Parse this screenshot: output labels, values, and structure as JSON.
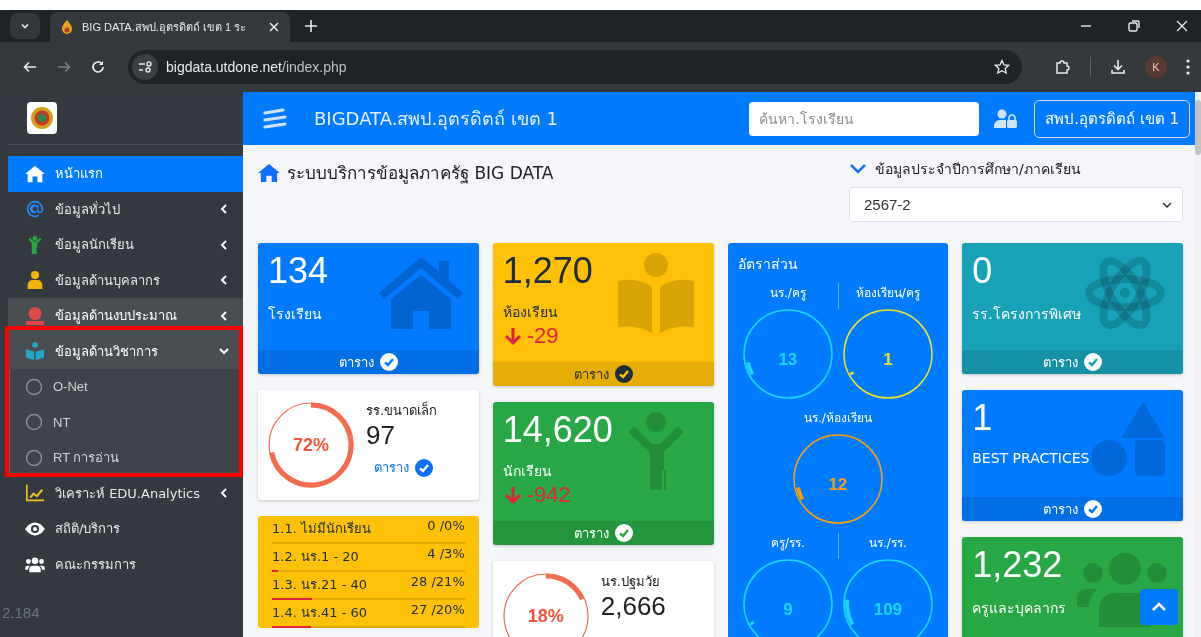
{
  "browser": {
    "tabs": [
      {
        "title": "BIG DATA.สพป.อุตรดิตถ์ เขต 1 ระ"
      }
    ],
    "url_host": "bigdata.utdone.net",
    "url_path": "/index.php",
    "profile": "K"
  },
  "sidebar": {
    "version": "2.184",
    "items": [
      {
        "label": "หน้าแรก",
        "selected": true,
        "hovered": false
      },
      {
        "label": "ข้อมูลทั่วไป",
        "selected": false,
        "hovered": false,
        "expanded": false
      },
      {
        "label": "ข้อมูลนักเรียน",
        "selected": false,
        "hovered": false,
        "expanded": false
      },
      {
        "label": "ข้อมูลด้านบุคลากร",
        "selected": false,
        "hovered": false,
        "expanded": false
      },
      {
        "label": "ข้อมูลด้านงบประมาณ",
        "selected": false,
        "hovered": true,
        "expanded": false
      },
      {
        "label": "ข้อมูลด้านวิชาการ",
        "selected": false,
        "hovered": false,
        "expanded": true,
        "children": [
          {
            "label": "O-Net",
            "selected": false
          },
          {
            "label": "NT",
            "selected": false
          },
          {
            "label": "RT การอ่าน",
            "selected": false
          }
        ]
      },
      {
        "label": "วิเคราะห์ EDU.Analytics",
        "selected": false,
        "hovered": false,
        "expanded": false
      },
      {
        "label": "สถิติ/บริการ",
        "selected": false,
        "hovered": false
      },
      {
        "label": "คณะกรรมการ",
        "selected": false,
        "hovered": false
      }
    ]
  },
  "header": {
    "title": "BIGDATA.สพป.อุตรดิตถ์ เขต 1",
    "search": {
      "placeholder": "ค้นหา.โรงเรียน"
    },
    "account_button": "สพป.อุตรดิตถ์ เขต 1"
  },
  "content": {
    "title": "ระบบบริการข้อมูลภาครัฐ BIG DATA",
    "year_label": "ข้อมูลประจำปีการศึกษา/ภาคเรียน",
    "year_select": "2567-2",
    "columns": [
      [
        {
          "kind": "stat",
          "color": "#007bff",
          "value": "134",
          "label": "โรงเรียน",
          "link": "ตาราง"
        },
        {
          "kind": "donut",
          "percent": "72%",
          "label": "รร.ขนาดเล็ก",
          "value": "97",
          "link": "ตาราง"
        },
        {
          "kind": "list",
          "rows": [
            {
              "label": "1.1. ไม่มีนักเรียน",
              "value": "0 /0%",
              "level": 0
            },
            {
              "label": "1.2. นร.1 - 20",
              "value": "4 /3%",
              "level": 0.03
            },
            {
              "label": "1.3. นร.21 - 40",
              "value": "28 /21%",
              "level": 0.21
            },
            {
              "label": "1.4. นร.41 - 60",
              "value": "27 /20%",
              "level": 0.2
            }
          ]
        }
      ],
      [
        {
          "kind": "stat",
          "color": "#ffc107",
          "value": "1,270",
          "label": "ห้องเรียน",
          "change": "-29",
          "link": "ตาราง"
        },
        {
          "kind": "stat",
          "color": "#28a745",
          "value": "14,620",
          "label": "นักเรียน",
          "change": "-942",
          "link": "ตาราง"
        },
        {
          "kind": "donut",
          "percent": "18%",
          "label": "นร.ปฐมวัย",
          "value": "2,666"
        }
      ],
      [
        {
          "kind": "ratio",
          "title": "อัตราส่วน",
          "rows": [
            [
              {
                "label": "นร./ครู",
                "value": "13",
                "color": "#18d6ff"
              },
              {
                "label": "ห้องเรียน/ครู",
                "value": "1",
                "color": "#e6e229"
              }
            ],
            [
              {
                "label": "นร./ห้องเรียน",
                "value": "12",
                "color": "#f29f0f"
              }
            ],
            [
              {
                "label": "ครู/รร.",
                "value": "9",
                "color": "#18d6ff"
              },
              {
                "label": "นร./รร.",
                "value": "109",
                "color": "#18d6ff"
              }
            ]
          ]
        }
      ],
      [
        {
          "kind": "stat",
          "color": "#17a2b8",
          "value": "0",
          "label": "รร.โครงการพิเศษ",
          "link": "ตาราง"
        },
        {
          "kind": "stat",
          "color": "#007bff",
          "value": "1",
          "label": "BEST PRACTICES",
          "link": "ตาราง"
        },
        {
          "kind": "stat",
          "color": "#28a745",
          "value": "1,232",
          "label": "ครูและบุคลากร"
        }
      ]
    ]
  }
}
